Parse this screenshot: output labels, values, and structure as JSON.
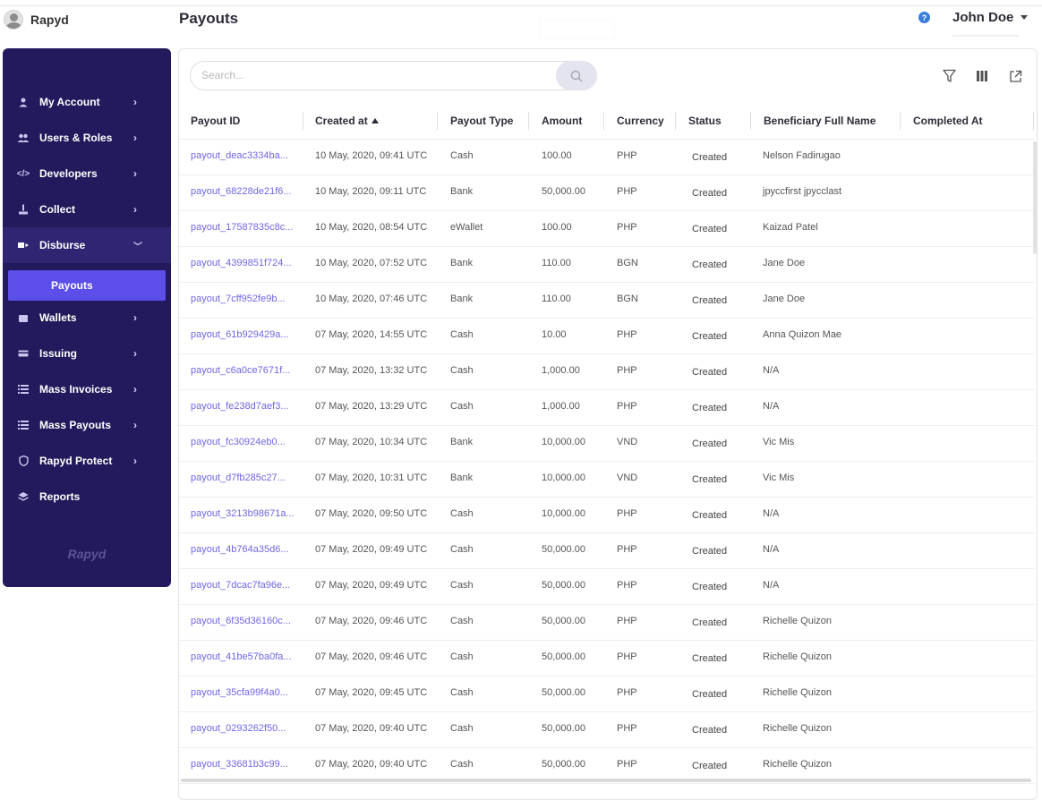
{
  "header": {
    "brand_name": "Rapyd",
    "page_title": "Payouts",
    "help_label": "?",
    "user_name": "John Doe"
  },
  "sidebar": {
    "items": [
      {
        "label": "My Account",
        "icon": "user-icon"
      },
      {
        "label": "Users & Roles",
        "icon": "users-icon"
      },
      {
        "label": "Developers",
        "icon": "code-icon"
      },
      {
        "label": "Collect",
        "icon": "collect-icon"
      },
      {
        "label": "Disburse",
        "icon": "disburse-icon"
      },
      {
        "label": "Wallets",
        "icon": "wallet-icon"
      },
      {
        "label": "Issuing",
        "icon": "card-icon"
      },
      {
        "label": "Mass Invoices",
        "icon": "mass-invoices-icon"
      },
      {
        "label": "Mass Payouts",
        "icon": "mass-payouts-icon"
      },
      {
        "label": "Rapyd Protect",
        "icon": "shield-icon"
      },
      {
        "label": "Reports",
        "icon": "reports-icon"
      }
    ],
    "sub_item": "Payouts",
    "logo": "Rapyd"
  },
  "search": {
    "placeholder": "Search..."
  },
  "table": {
    "columns": [
      "Payout ID",
      "Created at",
      "Payout Type",
      "Amount",
      "Currency",
      "Status",
      "Beneficiary Full Name",
      "Completed At"
    ],
    "rows": [
      [
        "payout_deac3334ba...",
        "10 May, 2020, 09:41 UTC",
        "Cash",
        "100.00",
        "PHP",
        "Created",
        "Nelson Fadirugao",
        ""
      ],
      [
        "payout_68228de21f6...",
        "10 May, 2020, 09:11 UTC",
        "Bank",
        "50,000.00",
        "PHP",
        "Created",
        "jpyccfirst jpycclast",
        ""
      ],
      [
        "payout_17587835c8c...",
        "10 May, 2020, 08:54 UTC",
        "eWallet",
        "100.00",
        "PHP",
        "Created",
        "Kaizad Patel",
        ""
      ],
      [
        "payout_4399851f724...",
        "10 May, 2020, 07:52 UTC",
        "Bank",
        "110.00",
        "BGN",
        "Created",
        "Jane Doe",
        ""
      ],
      [
        "payout_7cff952fe9b...",
        "10 May, 2020, 07:46 UTC",
        "Bank",
        "110.00",
        "BGN",
        "Created",
        "Jane Doe",
        ""
      ],
      [
        "payout_61b929429a...",
        "07 May, 2020, 14:55 UTC",
        "Cash",
        "10.00",
        "PHP",
        "Created",
        "Anna Quizon Mae",
        ""
      ],
      [
        "payout_c6a0ce7671f...",
        "07 May, 2020, 13:32 UTC",
        "Cash",
        "1,000.00",
        "PHP",
        "Created",
        "N/A",
        ""
      ],
      [
        "payout_fe238d7aef3...",
        "07 May, 2020, 13:29 UTC",
        "Cash",
        "1,000.00",
        "PHP",
        "Created",
        "N/A",
        ""
      ],
      [
        "payout_fc30924eb0...",
        "07 May, 2020, 10:34 UTC",
        "Bank",
        "10,000.00",
        "VND",
        "Created",
        "Vic Mis",
        ""
      ],
      [
        "payout_d7fb285c27...",
        "07 May, 2020, 10:31 UTC",
        "Bank",
        "10,000.00",
        "VND",
        "Created",
        "Vic Mis",
        ""
      ],
      [
        "payout_3213b98671a...",
        "07 May, 2020, 09:50 UTC",
        "Cash",
        "10,000.00",
        "PHP",
        "Created",
        "N/A",
        ""
      ],
      [
        "payout_4b764a35d6...",
        "07 May, 2020, 09:49 UTC",
        "Cash",
        "50,000.00",
        "PHP",
        "Created",
        "N/A",
        ""
      ],
      [
        "payout_7dcac7fa96e...",
        "07 May, 2020, 09:49 UTC",
        "Cash",
        "50,000.00",
        "PHP",
        "Created",
        "N/A",
        ""
      ],
      [
        "payout_6f35d36160c...",
        "07 May, 2020, 09:46 UTC",
        "Cash",
        "50,000.00",
        "PHP",
        "Created",
        "Richelle Quizon",
        ""
      ],
      [
        "payout_41be57ba0fa...",
        "07 May, 2020, 09:46 UTC",
        "Cash",
        "50,000.00",
        "PHP",
        "Created",
        "Richelle Quizon",
        ""
      ],
      [
        "payout_35cfa99f4a0...",
        "07 May, 2020, 09:45 UTC",
        "Cash",
        "50,000.00",
        "PHP",
        "Created",
        "Richelle Quizon",
        ""
      ],
      [
        "payout_0293262f50...",
        "07 May, 2020, 09:40 UTC",
        "Cash",
        "50,000.00",
        "PHP",
        "Created",
        "Richelle Quizon",
        ""
      ],
      [
        "payout_33681b3c99...",
        "07 May, 2020, 09:40 UTC",
        "Cash",
        "50,000.00",
        "PHP",
        "Created",
        "Richelle Quizon",
        ""
      ]
    ]
  },
  "colors": {
    "sidebar_bg": "#221a5c",
    "active_bg": "#5c4ee8",
    "link": "#6f66e2",
    "help": "#3b7ddd"
  }
}
